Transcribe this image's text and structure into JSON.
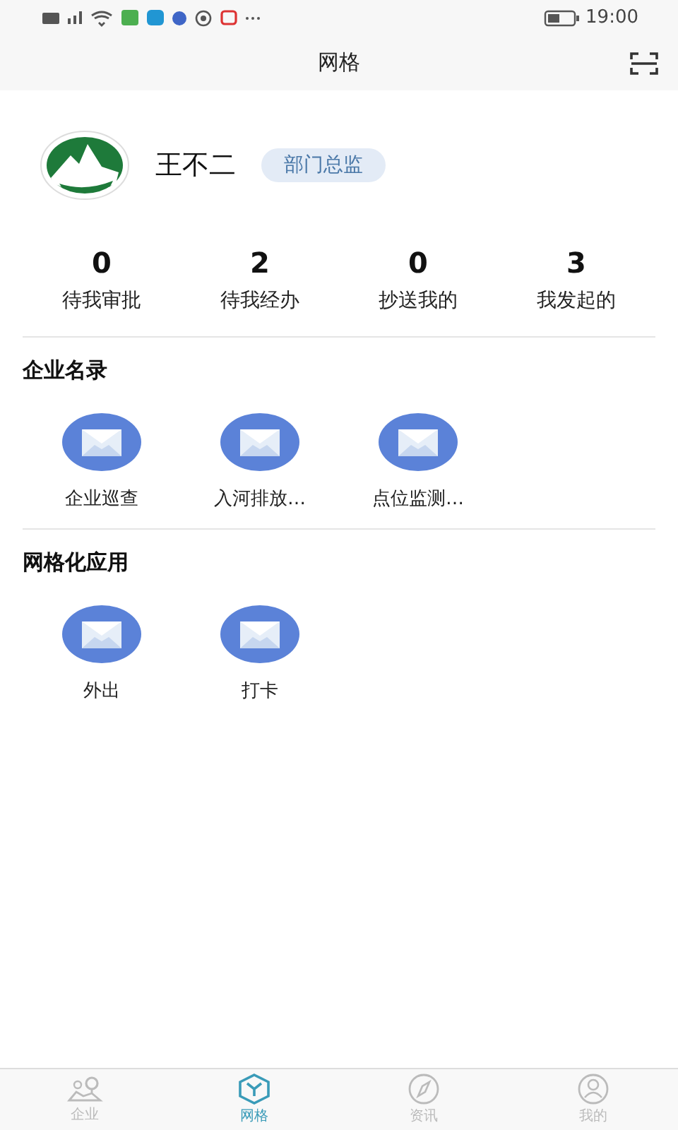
{
  "status_bar": {
    "time": "19:00"
  },
  "header": {
    "title": "网格"
  },
  "profile": {
    "name": "王不二",
    "role": "部门总监"
  },
  "stats": [
    {
      "value": "0",
      "label": "待我审批"
    },
    {
      "value": "2",
      "label": "待我经办"
    },
    {
      "value": "0",
      "label": "抄送我的"
    },
    {
      "value": "3",
      "label": "我发起的"
    }
  ],
  "sections": [
    {
      "title": "企业名录",
      "apps": [
        {
          "label": "企业巡查"
        },
        {
          "label": "入河排放…"
        },
        {
          "label": "点位监测…"
        }
      ]
    },
    {
      "title": "网格化应用",
      "apps": [
        {
          "label": "外出"
        },
        {
          "label": "打卡"
        }
      ]
    }
  ],
  "tabs": [
    {
      "label": "企业",
      "kind": "map",
      "selected": false
    },
    {
      "label": "网格",
      "kind": "cube",
      "selected": true
    },
    {
      "label": "资讯",
      "kind": "compass",
      "selected": false
    },
    {
      "label": "我的",
      "kind": "user",
      "selected": false
    }
  ]
}
